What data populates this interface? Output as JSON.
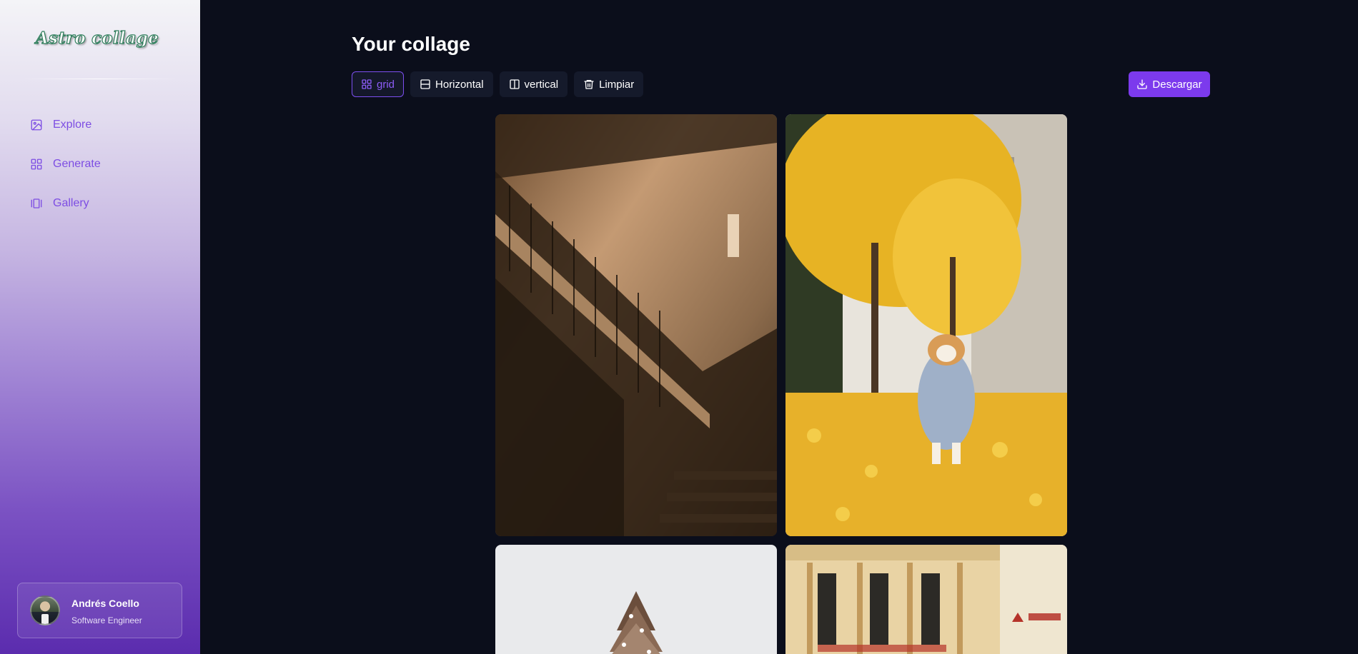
{
  "app": {
    "logo_text": "Astro collage"
  },
  "sidebar": {
    "items": [
      {
        "label": "Explore",
        "icon": "photo-icon"
      },
      {
        "label": "Generate",
        "icon": "grid-icon"
      },
      {
        "label": "Gallery",
        "icon": "gallery-icon"
      }
    ],
    "profile": {
      "name": "Andrés Coello",
      "role": "Software Engineer"
    }
  },
  "main": {
    "title": "Your collage",
    "layout_buttons": [
      {
        "label": "grid",
        "icon": "grid-icon",
        "active": true
      },
      {
        "label": "Horizontal",
        "icon": "horizontal-layout-icon",
        "active": false
      },
      {
        "label": "vertical",
        "icon": "vertical-layout-icon",
        "active": false
      },
      {
        "label": "Limpiar",
        "icon": "trash-icon",
        "active": false
      }
    ],
    "download_label": "Descargar",
    "images": [
      {
        "name": "staircase-photo"
      },
      {
        "name": "corgi-autumn-leaves-photo"
      },
      {
        "name": "snowy-tree-photo"
      },
      {
        "name": "building-facade-photo"
      }
    ]
  },
  "colors": {
    "background": "#0b0e1b",
    "accent": "#7c3aed",
    "nav_text": "#7d4de3"
  }
}
